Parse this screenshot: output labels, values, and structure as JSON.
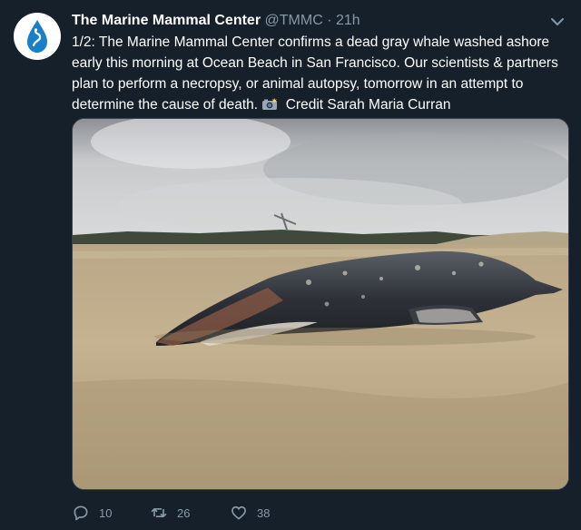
{
  "tweet": {
    "author_name": "The Marine Mammal Center",
    "handle": "@TMMC",
    "separator": "·",
    "time": "21h",
    "text_main": "1/2: The Marine Mammal Center confirms a dead gray whale washed ashore early this morning at Ocean Beach in San Francisco. Our scientists & partners plan to perform a necropsy, or animal autopsy, tomorrow in an attempt to determine the cause of death.",
    "credit": "Credit Sarah Maria Curran",
    "media_alt": "Dead gray whale lying on the sand at Ocean Beach under an overcast sky"
  },
  "actions": {
    "replies": "10",
    "retweets": "26",
    "likes": "38"
  },
  "icons": {
    "avatar": "water-drop-logo-icon",
    "menu": "chevron-down-icon",
    "credit": "camera-flash-icon",
    "reply": "reply-icon",
    "retweet": "retweet-icon",
    "like": "heart-icon"
  },
  "colors": {
    "background": "#15202b",
    "secondary_text": "#8899a6",
    "brand_blue": "#1d9bf0"
  }
}
